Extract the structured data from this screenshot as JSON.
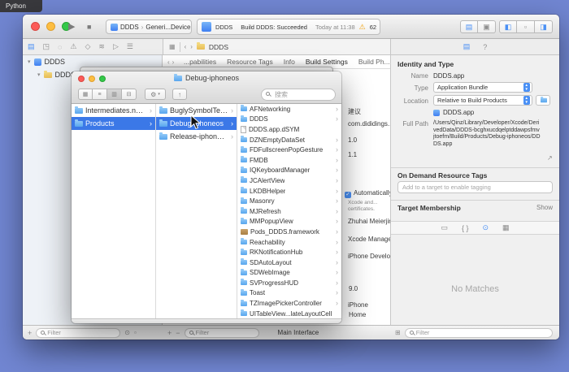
{
  "colors": {
    "selection_blue": "#3b78e7",
    "accent_blue": "#4a90f5",
    "warning_yellow": "#f1a10a",
    "folder_blue": "#6fb1f0"
  },
  "desktop": {
    "background_window_title": "Python"
  },
  "xcode": {
    "toolbar": {
      "scheme_target": "DDDS",
      "scheme_separator": "›",
      "scheme_device": "Generi...Device",
      "status_project": "DDDS",
      "status_build": "Build DDDS: Succeeded",
      "status_time": "Today at 11:38",
      "warning_count": "62"
    },
    "navigator_icons": [
      "project",
      "symbols",
      "find",
      "issues",
      "tests",
      "debug",
      "breakpoints",
      "reports"
    ],
    "jump_bar": {
      "item": "DDDS"
    },
    "tabs": [
      {
        "label": "...pabilities"
      },
      {
        "label": "Resource Tags"
      },
      {
        "label": "Info"
      },
      {
        "label": "Build Settings"
      },
      {
        "label": "Build Ph..."
      }
    ],
    "project_navigator": {
      "project": "DDDS",
      "group": "DDDS"
    },
    "editor": {
      "ime_hint": "建议",
      "bundle_identifier": "com.dididings...",
      "version": "1.0",
      "build": "1.1",
      "auto_signing": "Automatically",
      "signing_note_1": "Xcode and...",
      "signing_note_2": "certificates.",
      "team": "Zhuhai Meierjin...",
      "provisioning": "Xcode Managed",
      "certificate": "iPhone Develope...",
      "deployment_target": "9.0",
      "devices": "iPhone",
      "main_interface_label": "Main Interface",
      "main_interface_value": "Home"
    },
    "inspector": {
      "header_identity": "Identity and Type",
      "name_label": "Name",
      "name_value": "DDDS.app",
      "type_label": "Type",
      "type_value": "Application Bundle",
      "location_label": "Location",
      "location_value": "Relative to Build Products",
      "bundle_display": "DDDS.app",
      "full_path_label": "Full Path",
      "full_path_value": "/Users/Qinz/Library/Developer/Xcode/DerivedData/DDDS-bcghxucdqelptddawpsfmvjtoefm/Build/Products/Debug-iphoneos/DDDS.app",
      "header_odr": "On Demand Resource Tags",
      "odr_placeholder": "Add to a target to enable tagging",
      "header_target_membership": "Target Membership",
      "show_link": "Show",
      "library_icons": [
        "file-template",
        "code-snippet",
        "object",
        "media"
      ],
      "library_empty": "No Matches",
      "filter_placeholder": "Filter"
    },
    "bottom_bars": {
      "add": "+",
      "remove": "−",
      "navigator_filter": "Filter",
      "editor_filter": "Filter",
      "inspector_filter": "Filter"
    }
  },
  "finder": {
    "title": "Debug-iphoneos",
    "search_placeholder": "搜索",
    "columns": [
      {
        "items": [
          {
            "label": "Intermediates.noindex",
            "icon": "folder",
            "chevron": true,
            "selected": false
          },
          {
            "label": "Products",
            "icon": "folder",
            "chevron": true,
            "selected": true
          }
        ]
      },
      {
        "items": [
          {
            "label": "BuglySymbolTemp",
            "icon": "folder",
            "chevron": true,
            "selected": false
          },
          {
            "label": "Debug-iphoneos",
            "icon": "folder",
            "chevron": true,
            "selected": true
          },
          {
            "label": "Release-iphoneos",
            "icon": "folder",
            "chevron": true,
            "selected": false
          }
        ]
      },
      {
        "items": [
          {
            "label": "AFNetworking",
            "icon": "folder",
            "chevron": true
          },
          {
            "label": "DDDS",
            "icon": "folder",
            "chevron": true
          },
          {
            "label": "DDDS.app.dSYM",
            "icon": "doc",
            "chevron": false
          },
          {
            "label": "DZNEmptyDataSet",
            "icon": "folder",
            "chevron": true
          },
          {
            "label": "FDFullscreenPopGesture",
            "icon": "folder",
            "chevron": true
          },
          {
            "label": "FMDB",
            "icon": "folder",
            "chevron": true
          },
          {
            "label": "IQKeyboardManager",
            "icon": "folder",
            "chevron": true
          },
          {
            "label": "JCAlertView",
            "icon": "folder",
            "chevron": true
          },
          {
            "label": "LKDBHelper",
            "icon": "folder",
            "chevron": true
          },
          {
            "label": "Masonry",
            "icon": "folder",
            "chevron": true
          },
          {
            "label": "MJRefresh",
            "icon": "folder",
            "chevron": true
          },
          {
            "label": "MMPopupView",
            "icon": "folder",
            "chevron": true
          },
          {
            "label": "Pods_DDDS.framework",
            "icon": "framework",
            "chevron": true
          },
          {
            "label": "Reachability",
            "icon": "folder",
            "chevron": true
          },
          {
            "label": "RKNotificationHub",
            "icon": "folder",
            "chevron": true
          },
          {
            "label": "SDAutoLayout",
            "icon": "folder",
            "chevron": true
          },
          {
            "label": "SDWebImage",
            "icon": "folder",
            "chevron": true
          },
          {
            "label": "SVProgressHUD",
            "icon": "folder",
            "chevron": true
          },
          {
            "label": "Toast",
            "icon": "folder",
            "chevron": true
          },
          {
            "label": "TZImagePickerController",
            "icon": "folder",
            "chevron": true
          },
          {
            "label": "UITableView...lateLayoutCell",
            "icon": "folder",
            "chevron": false
          }
        ]
      }
    ]
  }
}
